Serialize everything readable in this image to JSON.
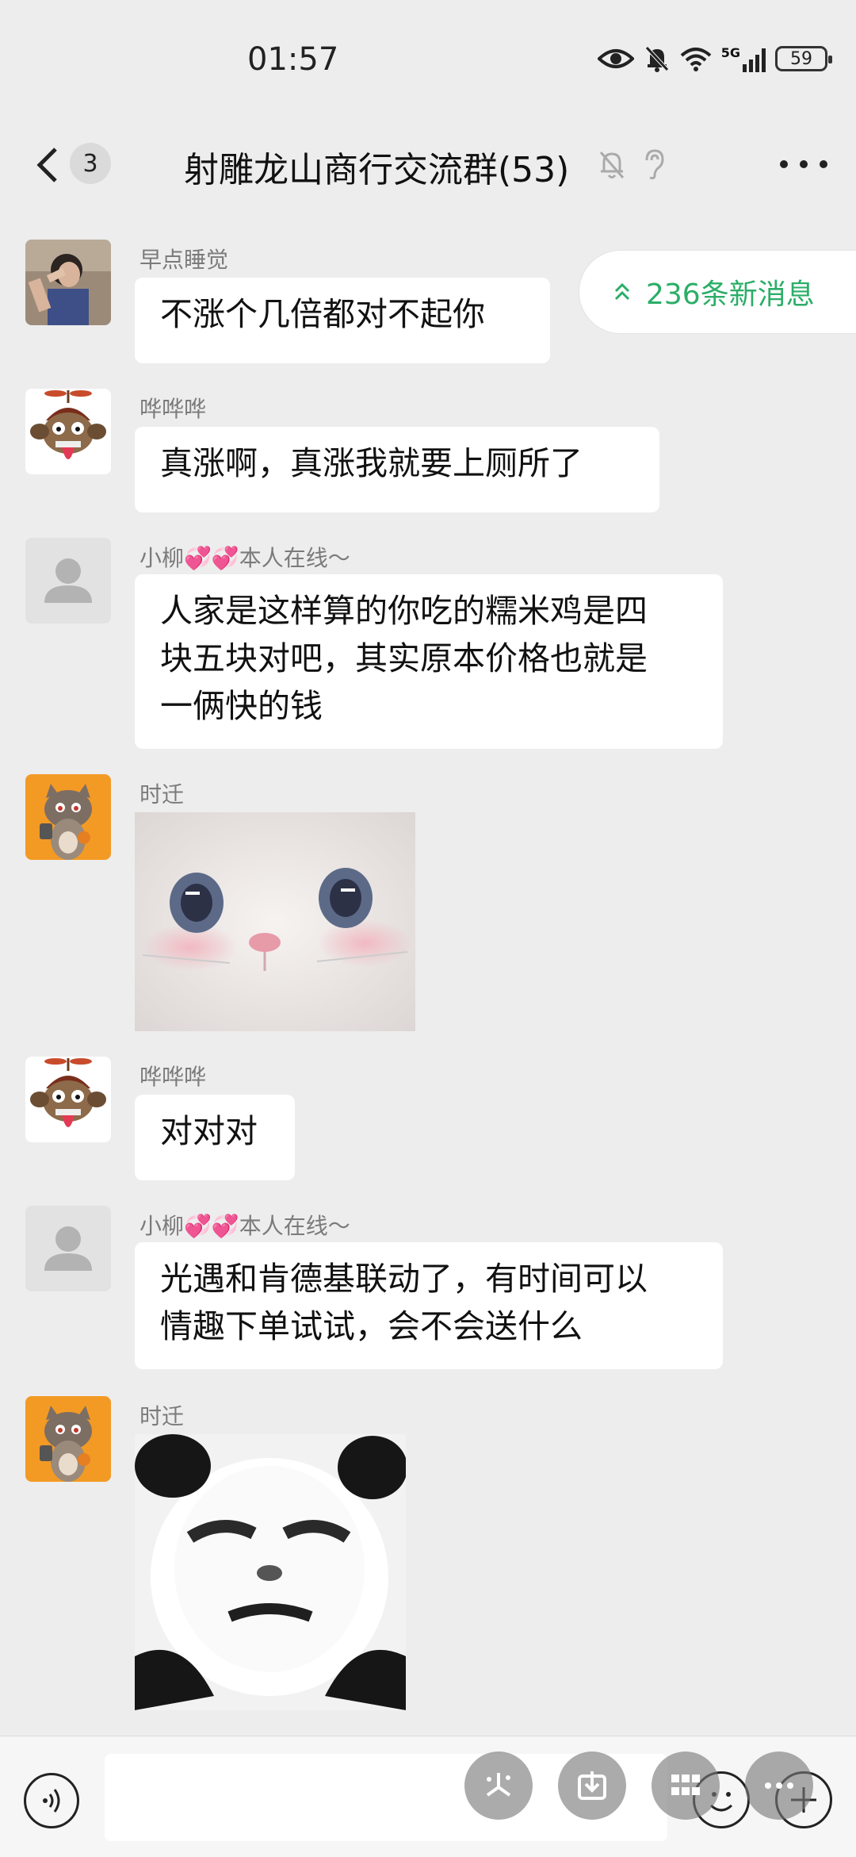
{
  "status": {
    "time": "01:57",
    "network": "5G",
    "battery": "59"
  },
  "header": {
    "unread_count": "3",
    "title": "射雕龙山商行交流群(53)"
  },
  "new_messages": {
    "label": "236条新消息"
  },
  "messages": [
    {
      "sender": "早点睡觉",
      "text": "不涨个几倍都对不起你"
    },
    {
      "sender": "哗哗哗",
      "text": "真涨啊，真涨我就要上厕所了"
    },
    {
      "sender": "小柳💞💞本人在线～",
      "text_line1": "人家是这样算的你吃的糯米鸡是四",
      "text_line2": "块五块对吧，其实原本价格也就是",
      "text_line3": "一俩快的钱"
    },
    {
      "sender": "时迁",
      "type": "sticker",
      "sticker": "white-cat-face"
    },
    {
      "sender": "哗哗哗",
      "text": "对对对"
    },
    {
      "sender": "小柳💞💞本人在线～",
      "text_line1": "光遇和肯德基联动了，有时间可以",
      "text_line2": "情趣下单试试，会不会送什么"
    },
    {
      "sender": "时迁",
      "type": "sticker",
      "sticker": "panda-meme-face"
    }
  ],
  "input": {
    "placeholder": ""
  },
  "icons": {
    "back": "chevron-left-icon",
    "mute": "bell-off-icon",
    "ear": "ear-icon",
    "more": "more-dots-icon",
    "voice": "voice-icon",
    "emoji": "emoji-icon",
    "plus": "plus-icon"
  },
  "colors": {
    "background": "#ededed",
    "accent_green": "#2aae67",
    "bubble": "#ffffff"
  }
}
